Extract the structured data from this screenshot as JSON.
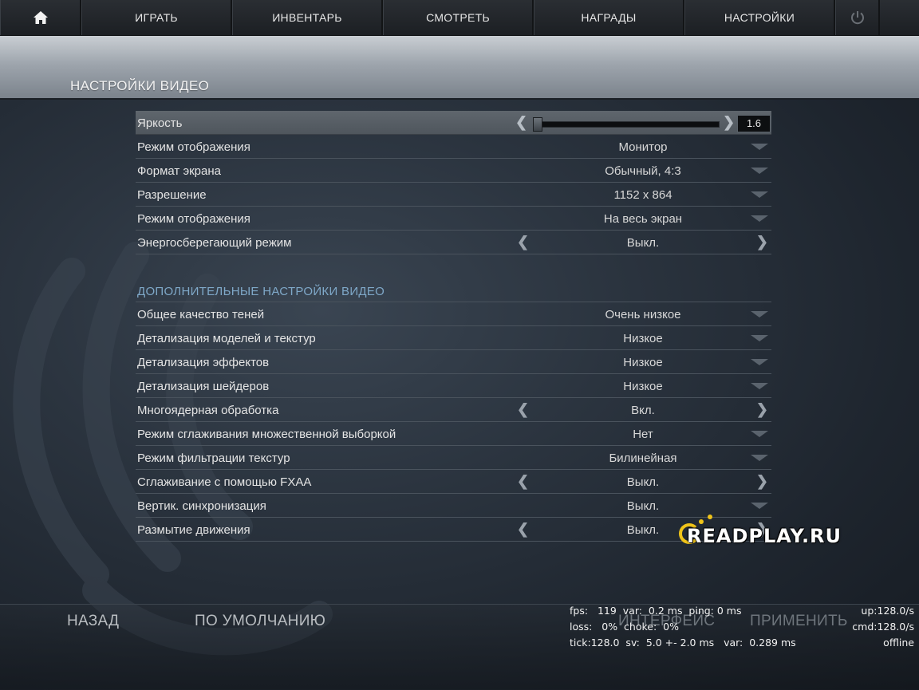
{
  "nav": {
    "items": [
      "ИГРАТЬ",
      "ИНВЕНТАРЬ",
      "СМОТРЕТЬ",
      "НАГРАДЫ",
      "НАСТРОЙКИ"
    ]
  },
  "page": {
    "title": "НАСТРОЙКИ ВИДЕО"
  },
  "brightness": {
    "label": "Яркость",
    "value": "1.6",
    "level_fraction": 0.0
  },
  "basic_settings": [
    {
      "label": "Режим отображения",
      "value": "Монитор",
      "control": "dropdown"
    },
    {
      "label": "Формат экрана",
      "value": "Обычный, 4:3",
      "control": "dropdown"
    },
    {
      "label": "Разрешение",
      "value": "1152 x 864",
      "control": "dropdown"
    },
    {
      "label": "Режим отображения",
      "value": "На весь экран",
      "control": "dropdown"
    },
    {
      "label": "Энергосберегающий режим",
      "value": "Выкл.",
      "control": "toggle"
    }
  ],
  "advanced": {
    "heading": "ДОПОЛНИТЕЛЬНЫЕ НАСТРОЙКИ ВИДЕО",
    "settings": [
      {
        "label": "Общее качество теней",
        "value": "Очень низкое",
        "control": "dropdown"
      },
      {
        "label": "Детализация моделей и текстур",
        "value": "Низкое",
        "control": "dropdown"
      },
      {
        "label": "Детализация эффектов",
        "value": "Низкое",
        "control": "dropdown"
      },
      {
        "label": "Детализация шейдеров",
        "value": "Низкое",
        "control": "dropdown"
      },
      {
        "label": "Многоядерная обработка",
        "value": "Вкл.",
        "control": "toggle"
      },
      {
        "label": "Режим сглаживания множественной выборкой",
        "value": "Нет",
        "control": "dropdown"
      },
      {
        "label": "Режим фильтрации текстур",
        "value": "Билинейная",
        "control": "dropdown"
      },
      {
        "label": "Сглаживание с помощью FXAA",
        "value": "Выкл.",
        "control": "toggle"
      },
      {
        "label": "Вертик. синхронизация",
        "value": "Выкл.",
        "control": "dropdown"
      },
      {
        "label": "Размытие движения",
        "value": "Выкл.",
        "control": "toggle"
      }
    ]
  },
  "watermark": {
    "text": "READPLAY.RU",
    "color": "#f0c419"
  },
  "footer": {
    "back": "НАЗАД",
    "defaults": "ПО УМОЛЧАНИЮ",
    "interface": "ИНТЕРФЕЙС",
    "apply": "ПРИМЕНИТЬ"
  },
  "netgraph": {
    "line1": "fps:   119  var:  0.2 ms  ping: 0 ms",
    "line1_right": "up:128.0/s",
    "line2": "loss:   0%  choke:  0%",
    "line2_right": "cmd:128.0/s",
    "line3": "tick:128.0  sv:  5.0 +- 2.0 ms   var:  0.289 ms",
    "line3_right": "offline"
  },
  "icons": {
    "home": "home-icon",
    "power": "power-icon"
  }
}
